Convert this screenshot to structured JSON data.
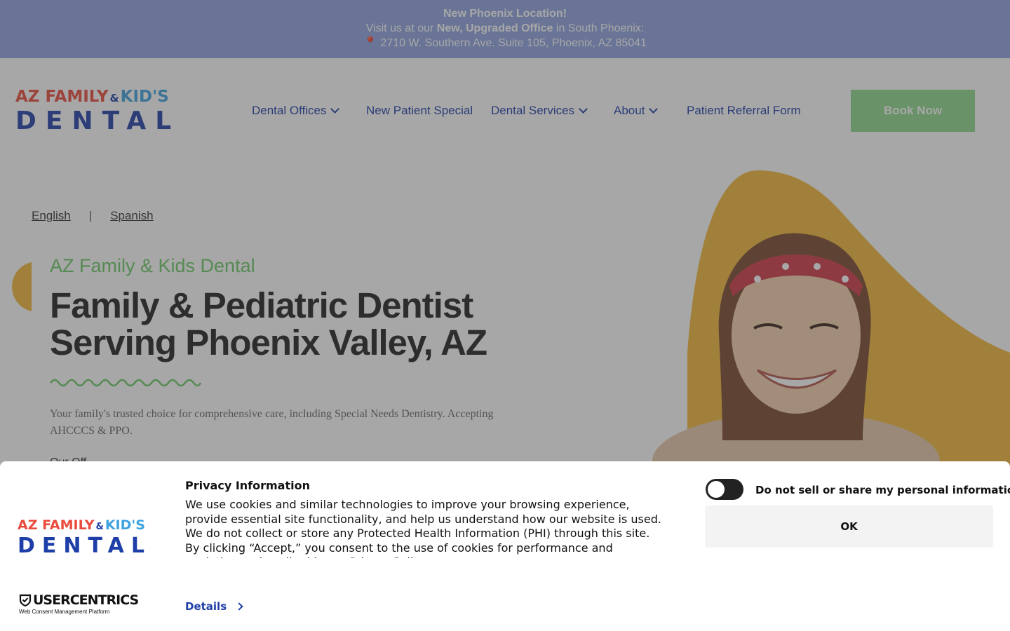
{
  "announcement": {
    "title": "New Phoenix Location!",
    "line2_prefix": "Visit us at our ",
    "line2_bold": "New, Upgraded Office",
    "line2_suffix": " in South Phoenix:",
    "address": "📍 2710 W. Southern Ave. Suite 105, Phoenix, AZ 85041",
    "bg_color": "#8fa3e0"
  },
  "logo": {
    "line1_a": "AZ FAMILY",
    "line1_amp": "&",
    "line1_b": "KID'S",
    "line2": "DENTAL"
  },
  "nav": {
    "items": [
      {
        "label": "Dental Offices",
        "dropdown": true
      },
      {
        "label": "New Patient Special",
        "dropdown": false
      },
      {
        "label": "Dental Services",
        "dropdown": true
      },
      {
        "label": "About",
        "dropdown": true
      },
      {
        "label": "Patient Referral Form",
        "dropdown": false
      }
    ],
    "book_label": "Book Now"
  },
  "hero": {
    "lang_english": "English",
    "lang_sep": "|",
    "lang_spanish": "Spanish",
    "eyebrow": "AZ Family & Kids Dental",
    "title_line1": "Family & Pediatric Dentist",
    "title_line2": "Serving Phoenix Valley, AZ",
    "subtitle": "Your family's trusted choice for comprehensive care, including Special Needs Dentistry. Accepting AHCCCS & PPO.",
    "peek": "Our Off..."
  },
  "consent": {
    "title": "Privacy Information",
    "text": "We use cookies and similar technologies to improve your browsing experience, provide essential site functionality, and help us understand how our website is used. We do not collect or store any Protected Health Information (PHI) through this site. By clicking “Accept,” you consent to the use of cookies for performance and analytics as described in our Privacy Policy.",
    "details_label": "Details",
    "toggle_label": "Do not sell or share my personal information",
    "toggle_on": false,
    "ok_label": "OK",
    "brand_name": "USERCENTRICS",
    "brand_tagline": "Web Consent Management Platform"
  },
  "colors": {
    "brand_blue": "#1f3fa8",
    "accent_green": "#8fd98c",
    "accent_yellow": "#f2b93b"
  }
}
